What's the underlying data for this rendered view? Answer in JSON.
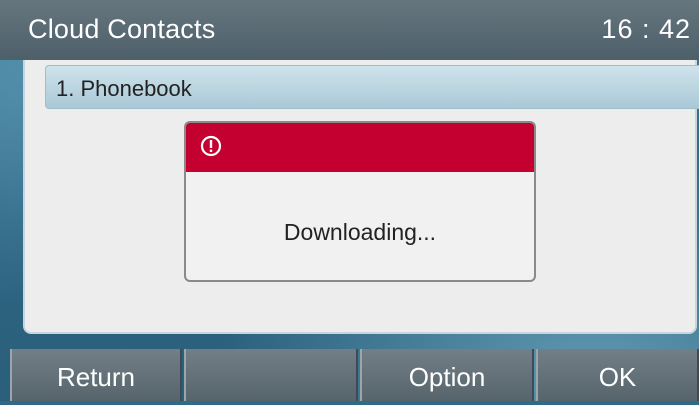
{
  "header": {
    "title": "Cloud Contacts",
    "time": "16 : 42"
  },
  "list": {
    "items": [
      {
        "label": "1. Phonebook"
      }
    ]
  },
  "dialog": {
    "icon": "alert-circle-icon",
    "message": "Downloading...",
    "accent_color": "#c40031"
  },
  "softkeys": [
    {
      "label": "Return"
    },
    {
      "label": ""
    },
    {
      "label": "Option"
    },
    {
      "label": "OK"
    }
  ]
}
